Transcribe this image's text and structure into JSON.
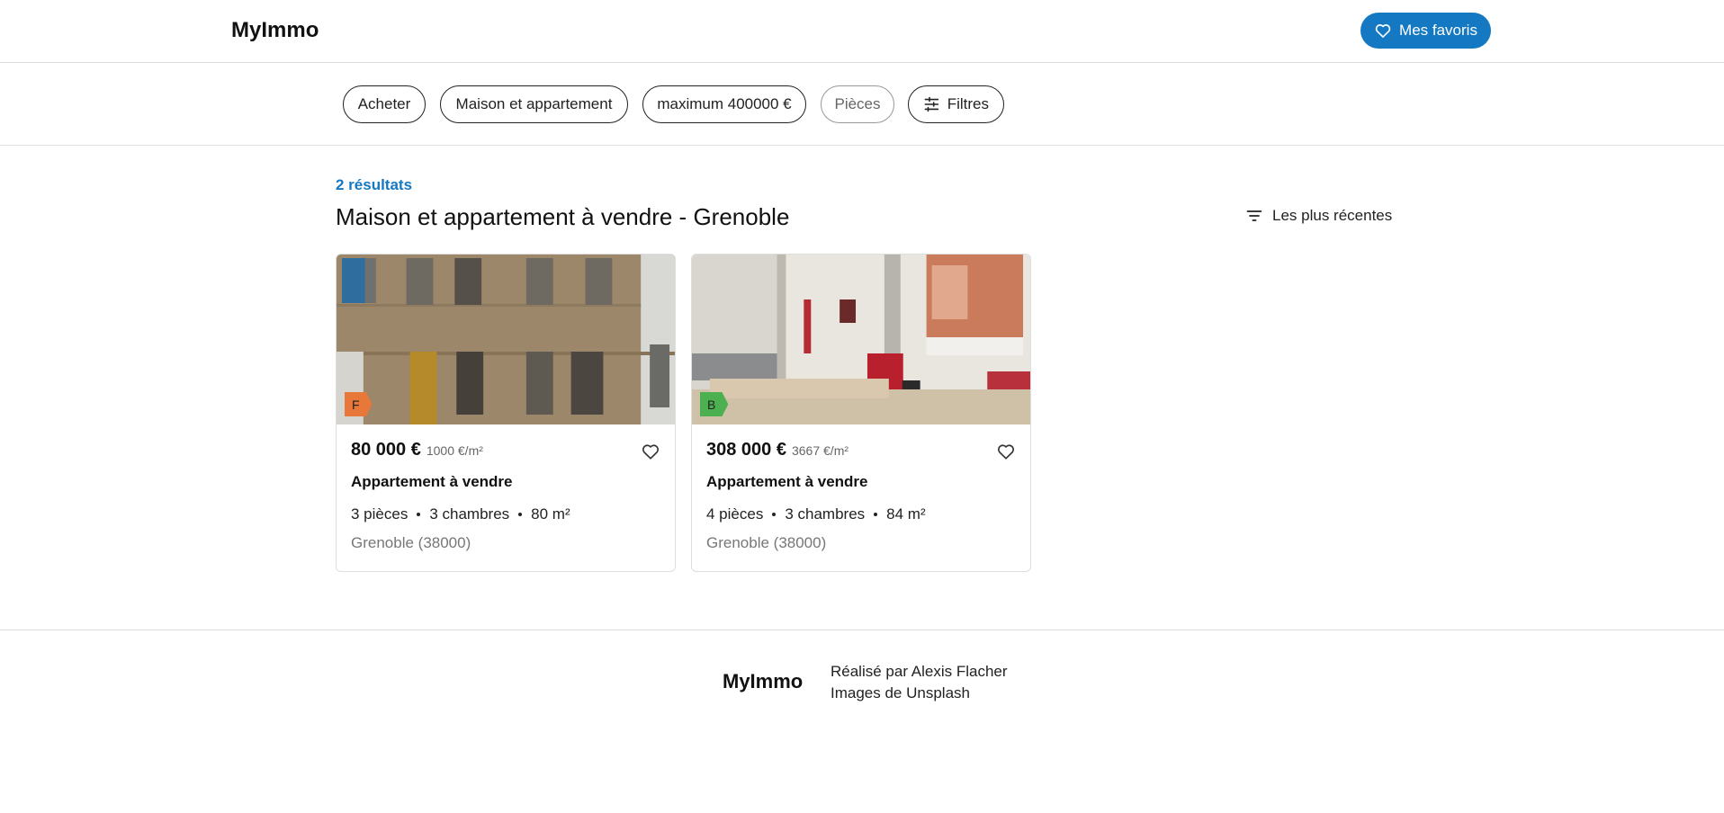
{
  "header": {
    "logo": "MyImmo",
    "favorites_label": "Mes favoris"
  },
  "filters": [
    {
      "label": "Acheter"
    },
    {
      "label": "Maison et appartement"
    },
    {
      "label": "maximum 400000 €"
    },
    {
      "label": "Pièces"
    },
    {
      "label": "Filtres"
    }
  ],
  "results": {
    "count_label": "2 résultats",
    "title": "Maison et appartement à vendre - Grenoble",
    "sort_label": "Les plus récentes"
  },
  "listings": [
    {
      "energy_class": "F",
      "energy_color": "#e8783a",
      "price": "80 000 €",
      "price_per_m2": "1000 €/m²",
      "type": "Appartement à vendre",
      "rooms": "3 pièces",
      "bedrooms": "3 chambres",
      "surface": "80 m²",
      "city": "Grenoble (38000)"
    },
    {
      "energy_class": "B",
      "energy_color": "#4cb050",
      "price": "308 000 €",
      "price_per_m2": "3667 €/m²",
      "type": "Appartement à vendre",
      "rooms": "4 pièces",
      "bedrooms": "3 chambres",
      "surface": "84 m²",
      "city": "Grenoble (38000)"
    }
  ],
  "footer": {
    "logo": "MyImmo",
    "credit_author": "Réalisé par Alexis Flacher",
    "credit_images": "Images de Unsplash"
  },
  "colors": {
    "accent": "#1478c2"
  }
}
